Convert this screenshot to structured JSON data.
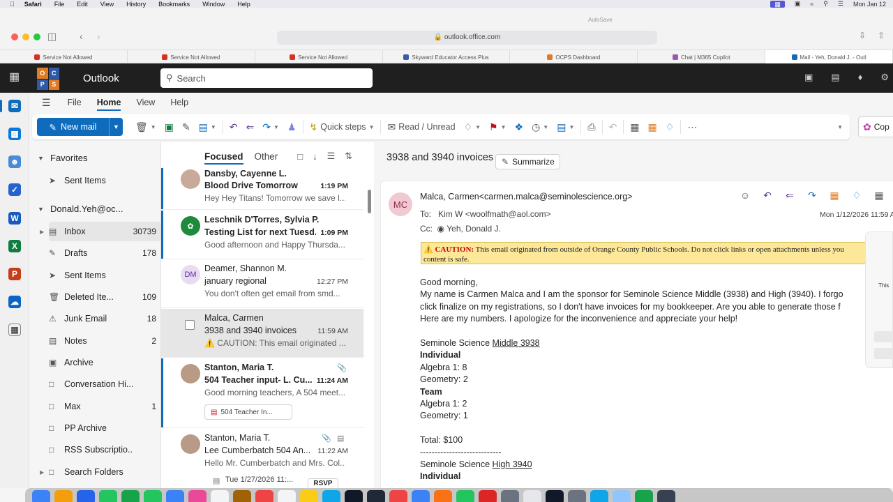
{
  "menubar": {
    "app": "Safari",
    "items": [
      "File",
      "Edit",
      "View",
      "History",
      "Bookmarks",
      "Window",
      "Help"
    ],
    "clock": "Mon Jan 12"
  },
  "safari": {
    "url": "outlook.office.com",
    "autosave": "AutoSave",
    "tabs": [
      {
        "label": "Service Not Allowed",
        "color": "#d93025"
      },
      {
        "label": "Service Not Allowed",
        "color": "#d93025"
      },
      {
        "label": "Service Not Allowed",
        "color": "#d93025"
      },
      {
        "label": "Skyward Educator Access Plus",
        "color": "#3c5aa8"
      },
      {
        "label": "OCPS Dashboard",
        "color": "#e07b24"
      },
      {
        "label": "Chat | M365 Copilot",
        "color": "#9b59b6"
      },
      {
        "label": "Mail - Yeh, Donald J. - Outl",
        "color": "#0f6cbd"
      }
    ]
  },
  "header": {
    "logo_letters": [
      "O",
      "C",
      "P",
      "S"
    ],
    "app_name": "Outlook",
    "search_placeholder": "Search"
  },
  "ribbon": {
    "tabs": [
      "File",
      "Home",
      "View",
      "Help"
    ],
    "active_tab": "Home",
    "new_mail": "New mail",
    "quick_steps": "Quick steps",
    "read_unread": "Read / Unread",
    "copilot": "Cop"
  },
  "folders": {
    "favorites_header": "Favorites",
    "favorites": [
      {
        "label": "Sent Items",
        "count": ""
      }
    ],
    "account": "Donald.Yeh@oc...",
    "items": [
      {
        "label": "Inbox",
        "count": "30739"
      },
      {
        "label": "Drafts",
        "count": "178"
      },
      {
        "label": "Sent Items",
        "count": ""
      },
      {
        "label": "Deleted Ite...",
        "count": "109"
      },
      {
        "label": "Junk Email",
        "count": "18"
      },
      {
        "label": "Notes",
        "count": "2"
      },
      {
        "label": "Archive",
        "count": ""
      },
      {
        "label": "Conversation Hi...",
        "count": ""
      },
      {
        "label": "Max",
        "count": "1"
      },
      {
        "label": "PP Archive",
        "count": ""
      },
      {
        "label": "RSS Subscriptio...",
        "count": ""
      }
    ],
    "search_folders": "Search Folders"
  },
  "message_list": {
    "tabs": [
      "Focused",
      "Other"
    ],
    "messages": [
      {
        "sender": "Dansby, Cayenne L.",
        "subject": "Blood Drive Tomorrow",
        "time": "1:19 PM",
        "preview": "Hey Hey Titans! Tomorrow we save l...",
        "initials": ""
      },
      {
        "sender": "Leschnik D'Torres, Sylvia P.",
        "subject": "Testing List for next Tuesd...",
        "time": "1:09 PM",
        "preview": "Good afternoon and Happy Thursda...",
        "initials": ""
      },
      {
        "sender": "Deamer, Shannon M.",
        "subject": "january regional",
        "time": "12:27 PM",
        "preview": "You don't often get email from smd...",
        "initials": "DM"
      },
      {
        "sender": "Malca, Carmen",
        "subject": "3938 and 3940 invoices",
        "time": "11:59 AM",
        "preview": "⚠️ CAUTION: This email originated ...",
        "initials": ""
      },
      {
        "sender": "Stanton, Maria T.",
        "subject": "504 Teacher input- L. Cu...",
        "time": "11:24 AM",
        "preview": "Good morning teachers, A 504 meet...",
        "initials": "",
        "attachment": "504 Teacher In..."
      },
      {
        "sender": "Stanton, Maria T.",
        "subject": "Lee Cumberbatch 504 An...",
        "time": "11:22 AM",
        "preview": "Hello Mr. Cumberbatch and Mrs. Col...",
        "initials": "",
        "event": "Tue 1/27/2026 11:...",
        "rsvp": "RSVP"
      }
    ]
  },
  "reading": {
    "subject": "3938 and 3940 invoices",
    "summarize": "Summarize",
    "avatar_initials": "MC",
    "from": "Malca, Carmen<carmen.malca@seminolescience.org>",
    "to_label": "To:",
    "to": "Kim W <woolfmath@aol.com>",
    "cc_label": "Cc:",
    "cc": "Yeh, Donald J.",
    "date": "Mon 1/12/2026 11:59 A",
    "caution_label": "CAUTION:",
    "caution_text": "This email originated from outside of Orange County Public Schools. Do not click links or open attachments unless you",
    "caution_text2": "content is safe.",
    "body": {
      "greeting": "Good morning,",
      "line1": "My name is Carmen Malca and I am the sponsor for Seminole Science Middle (3938) and High (3940). I forgo",
      "line2": "click finalize on my registrations, so I don't have invoices for my bookkeeper. Are you able to generate those f",
      "line3": "Here are my numbers. I apologize for the inconvenience and appreciate your help!",
      "school1_prefix": "Seminole Science ",
      "school1_link": "Middle 3938",
      "individual": "Individual",
      "alg1": "Algebra 1: 8",
      "geo1": "Geometry: 2",
      "team": "Team",
      "alg2": "Algebra 1: 2",
      "geo2": "Geometry: 1",
      "total": "Total: $100",
      "divider": "----------------------------",
      "school2_prefix": "Seminole Science ",
      "school2_link": "High 3940",
      "individual2": "Individual"
    }
  },
  "side_panel": {
    "text": "This"
  }
}
